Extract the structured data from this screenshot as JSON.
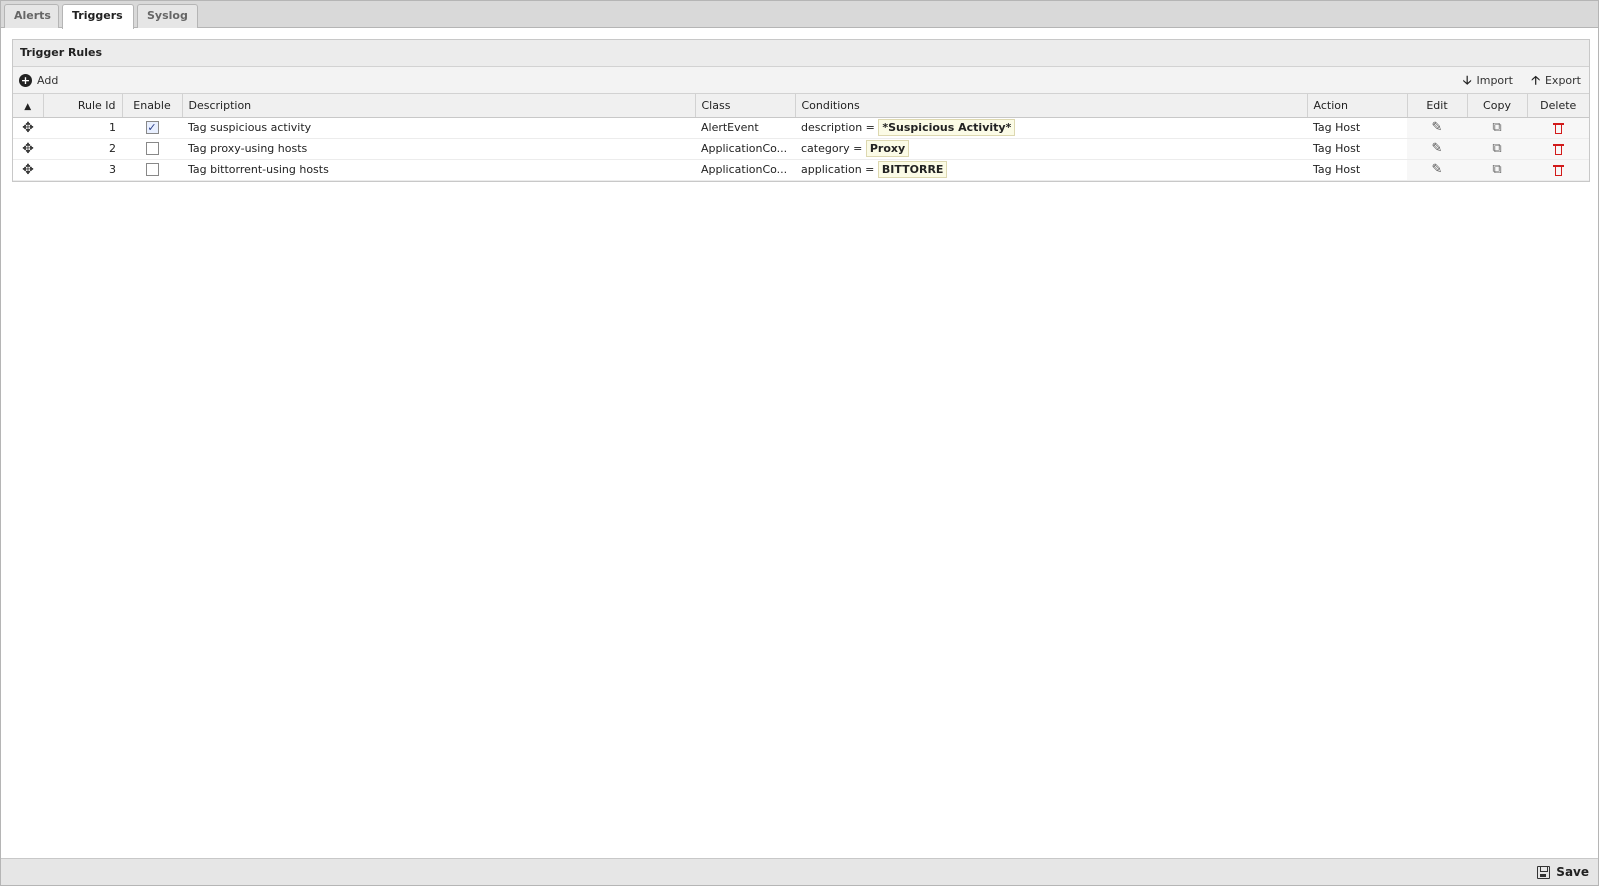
{
  "tabs": [
    {
      "label": "Alerts",
      "active": false
    },
    {
      "label": "Triggers",
      "active": true
    },
    {
      "label": "Syslog",
      "active": false
    }
  ],
  "panel": {
    "title": "Trigger Rules",
    "toolbar": {
      "add_label": "Add",
      "import_label": "Import",
      "export_label": "Export"
    }
  },
  "table": {
    "columns": {
      "rule_id": "Rule Id",
      "enable": "Enable",
      "description": "Description",
      "class": "Class",
      "conditions": "Conditions",
      "action": "Action",
      "edit": "Edit",
      "copy": "Copy",
      "delete": "Delete"
    },
    "rows": [
      {
        "rule_id": "1",
        "enabled": true,
        "description": "Tag suspicious activity",
        "class": "AlertEvent",
        "cond_field": "description =",
        "cond_value": "*Suspicious Activity*",
        "action": "Tag Host"
      },
      {
        "rule_id": "2",
        "enabled": false,
        "description": "Tag proxy-using hosts",
        "class": "ApplicationCo...",
        "cond_field": "category =",
        "cond_value": "Proxy",
        "action": "Tag Host"
      },
      {
        "rule_id": "3",
        "enabled": false,
        "description": "Tag bittorrent-using hosts",
        "class": "ApplicationCo...",
        "cond_field": "application =",
        "cond_value": "BITTORRE",
        "action": "Tag Host"
      }
    ]
  },
  "footer": {
    "save_label": "Save"
  }
}
